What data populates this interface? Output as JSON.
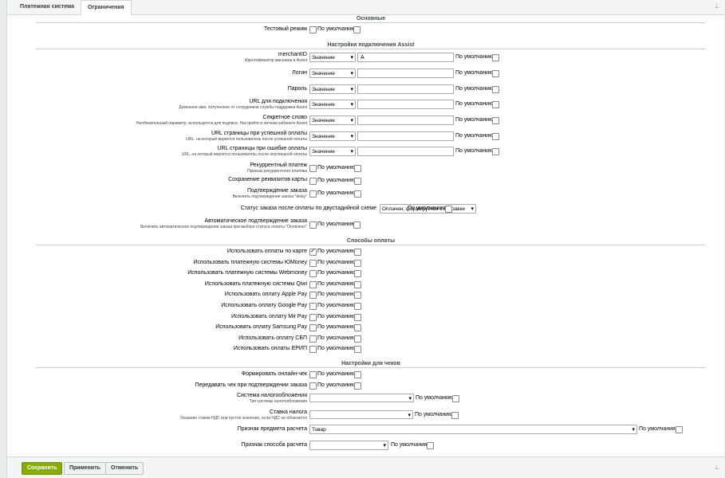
{
  "tabs": [
    "Платежная система",
    "Ограничения"
  ],
  "sections": {
    "main": "Основные",
    "assist": "Настройки подключения Assist",
    "payment": "Способы оплаты",
    "receipts": "Настройки для чеков"
  },
  "default_label": "По умолчанию",
  "test_mode": "Тестовый режим",
  "value_option": "Значение",
  "assist_fields": [
    {
      "label": "merchantID",
      "sub": "Идентификатор магазина в Assist",
      "value": "A"
    },
    {
      "label": "Логин",
      "sub": "",
      "value": ""
    },
    {
      "label": "Пароль",
      "sub": "",
      "value": ""
    },
    {
      "label": "URL для подключения",
      "sub": "Доменное имя, полученное от сотрудников службы поддержки Assist",
      "value": ""
    },
    {
      "label": "Секретное слово",
      "sub": "Необязательный параметр, используется для подписи. Настройте в личном кабинете Assist",
      "value": ""
    },
    {
      "label": "URL страницы при успешной оплаты",
      "sub": "URL, на который вернется пользователь после успешной оплаты",
      "value": ""
    },
    {
      "label": "URL страницы при ошибке оплаты",
      "sub": "URL, на который вернется пользователь после неуспешной оплаты",
      "value": ""
    }
  ],
  "assist_checks": [
    {
      "label": "Рекуррентный платеж",
      "sub": "Признак рекуррентного платежа"
    },
    {
      "label": "Сохранение реквизитов карты",
      "sub": ""
    },
    {
      "label": "Подтверждение заказа",
      "sub": "Включить подтверждение заказа \"delay\""
    }
  ],
  "status_label": "Статус заказа после оплаты по двустадийной схеме",
  "status_value": "Оплачен, формируется к отправке",
  "auto_confirm": {
    "label": "Автоматическое подтверждение заказа",
    "sub": "Включить автоматическое подтверждение заказа при выборе статуса оплаты \"Оплачено\""
  },
  "payment_methods": [
    {
      "label": "Использовать оплаты по карте",
      "checked": true
    },
    {
      "label": "Использовать платежную системы ЮMoney",
      "checked": false
    },
    {
      "label": "Использовать платежную системы Webmoney",
      "checked": false
    },
    {
      "label": "Использовать платежную системы Qiwi",
      "checked": false
    },
    {
      "label": "Использовать оплату Apple Pay",
      "checked": false
    },
    {
      "label": "Использовать оплату Google Pay",
      "checked": false
    },
    {
      "label": "Использовать оплату Mir Pay",
      "checked": false
    },
    {
      "label": "Использовать оплату Samsung Pay",
      "checked": false
    },
    {
      "label": "Использовать оплату СБП",
      "checked": false
    },
    {
      "label": "Использовать оплаты ЕРИП",
      "checked": false
    }
  ],
  "receipt_checks": [
    "Формировать онлайн-чек",
    "Передавать чек при подтверждении заказа"
  ],
  "tax_system": {
    "label": "Система налогообложения",
    "sub": "Тип системы налогообложения"
  },
  "vat_rate": {
    "label": "Ставка налога",
    "sub": "Указание ставки НДС или пустое значение, если НДС не облагается"
  },
  "item_sign": {
    "label": "Признак предмета расчета",
    "value": "Товар"
  },
  "payment_sign": {
    "label": "Признак способа расчета"
  },
  "buttons": {
    "save": "Сохранить",
    "apply": "Применить",
    "cancel": "Отменить"
  }
}
